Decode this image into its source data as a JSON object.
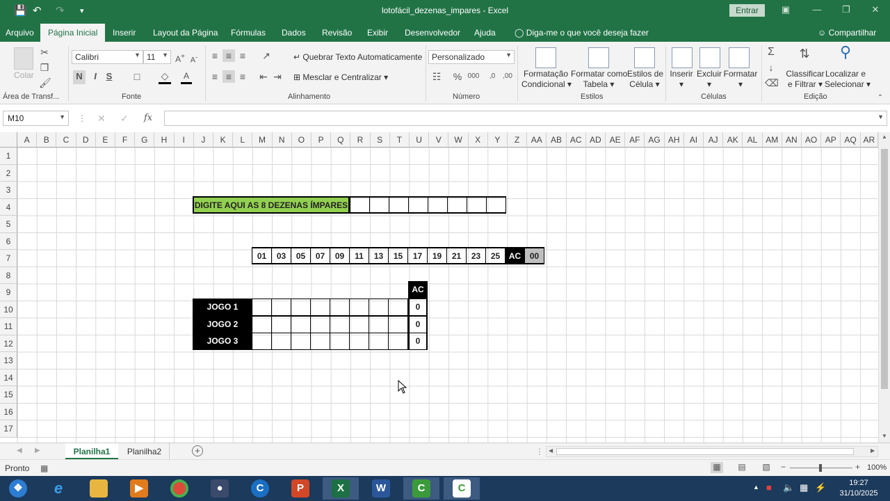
{
  "window": {
    "title": "lotofácil_dezenas_impares  -  Excel",
    "sign_in_label": "Entrar"
  },
  "menu": {
    "tabs": [
      "Arquivo",
      "Página Inicial",
      "Inserir",
      "Layout da Página",
      "Fórmulas",
      "Dados",
      "Revisão",
      "Exibir",
      "Desenvolvedor",
      "Ajuda"
    ],
    "active_tab": "Página Inicial",
    "tell_me": "Diga-me o que você deseja fazer",
    "share": "Compartilhar"
  },
  "ribbon": {
    "clipboard": {
      "paste_label": "Colar",
      "group_label": "Área de Transf..."
    },
    "font": {
      "name": "Calibri",
      "size": "11",
      "bold": "N",
      "italic": "I",
      "underline": "S",
      "group_label": "Fonte"
    },
    "alignment": {
      "wrap_text": "Quebrar Texto Automaticamente",
      "merge_center": "Mesclar e Centralizar",
      "group_label": "Alinhamento"
    },
    "number": {
      "format": "Personalizado",
      "group_label": "Número"
    },
    "styles": {
      "conditional_1": "Formatação",
      "conditional_2": "Condicional",
      "table_1": "Formatar como",
      "table_2": "Tabela",
      "cell_1": "Estilos de",
      "cell_2": "Célula",
      "group_label": "Estilos"
    },
    "cells": {
      "insert": "Inserir",
      "delete": "Excluir",
      "format": "Formatar",
      "group_label": "Células"
    },
    "editing": {
      "sort_1": "Classificar",
      "sort_2": "e Filtrar",
      "find_1": "Localizar e",
      "find_2": "Selecionar",
      "group_label": "Edição"
    }
  },
  "formula_bar": {
    "name_box": "M10",
    "fx": "fx",
    "value": ""
  },
  "sheet": {
    "columns": [
      "A",
      "B",
      "C",
      "D",
      "E",
      "F",
      "G",
      "H",
      "I",
      "J",
      "K",
      "L",
      "M",
      "N",
      "O",
      "P",
      "Q",
      "R",
      "S",
      "T",
      "U",
      "V",
      "W",
      "X",
      "Y",
      "Z",
      "AA",
      "AB",
      "AC",
      "AD",
      "AE",
      "AF",
      "AG",
      "AH",
      "AI",
      "AJ",
      "AK",
      "AL",
      "AM",
      "AN",
      "AO",
      "AP",
      "AQ",
      "AR"
    ],
    "rows": [
      "1",
      "2",
      "3",
      "4",
      "5",
      "6",
      "7",
      "8",
      "9",
      "10",
      "11",
      "12",
      "13",
      "14",
      "15",
      "16",
      "17"
    ],
    "instruction_label": "DIGITE AQUI AS 8 DEZENAS ÍMPARES",
    "odd_numbers": [
      "01",
      "03",
      "05",
      "07",
      "09",
      "11",
      "13",
      "15",
      "17",
      "19",
      "21",
      "23",
      "25"
    ],
    "ac_label": "AC",
    "zero_label": "00",
    "games": [
      {
        "label": "JOGO 1",
        "hits": "0"
      },
      {
        "label": "JOGO 2",
        "hits": "0"
      },
      {
        "label": "JOGO 3",
        "hits": "0"
      }
    ],
    "colors": {
      "instruction_bg": "#92d050",
      "black": "#000000",
      "gray": "#bfbfbf"
    }
  },
  "sheet_tabs": {
    "tabs": [
      "Planilha1",
      "Planilha2"
    ],
    "active": "Planilha1"
  },
  "status": {
    "mode": "Pronto",
    "zoom": "100%"
  },
  "taskbar": {
    "time": "19:27",
    "date": "31/10/2025"
  }
}
